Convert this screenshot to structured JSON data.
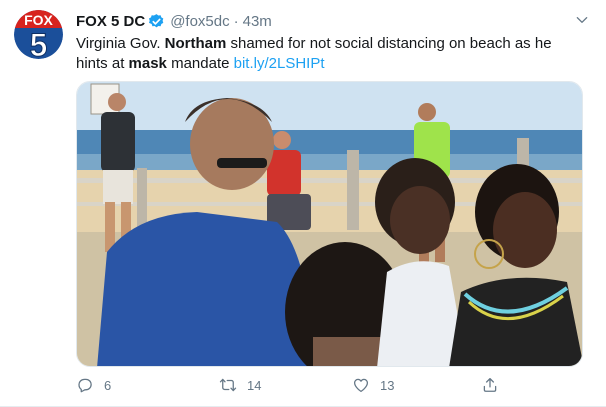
{
  "tweet": {
    "account_name": "FOX 5 DC",
    "handle": "@fox5dc",
    "separator": "·",
    "time": "43m",
    "text_1": "Virginia Gov. ",
    "text_bold_1": "Northam",
    "text_2": " shamed for not social distancing on beach as he hints at ",
    "text_bold_2": "mask",
    "text_3": " mandate ",
    "link": "bit.ly/2LSHIPt",
    "avatar_logo_text": "FOX",
    "avatar_logo_number": "5"
  },
  "actions": {
    "reply_count": "6",
    "retweet_count": "14",
    "like_count": "13"
  },
  "colors": {
    "accent": "#1da1f2",
    "muted": "#657786",
    "text": "#14171a",
    "fox_red": "#d7231e",
    "fox_blue": "#1b4f9a"
  },
  "icons": [
    "verified-badge-icon",
    "chevron-down-icon",
    "reply-icon",
    "retweet-icon",
    "like-icon",
    "share-icon"
  ]
}
